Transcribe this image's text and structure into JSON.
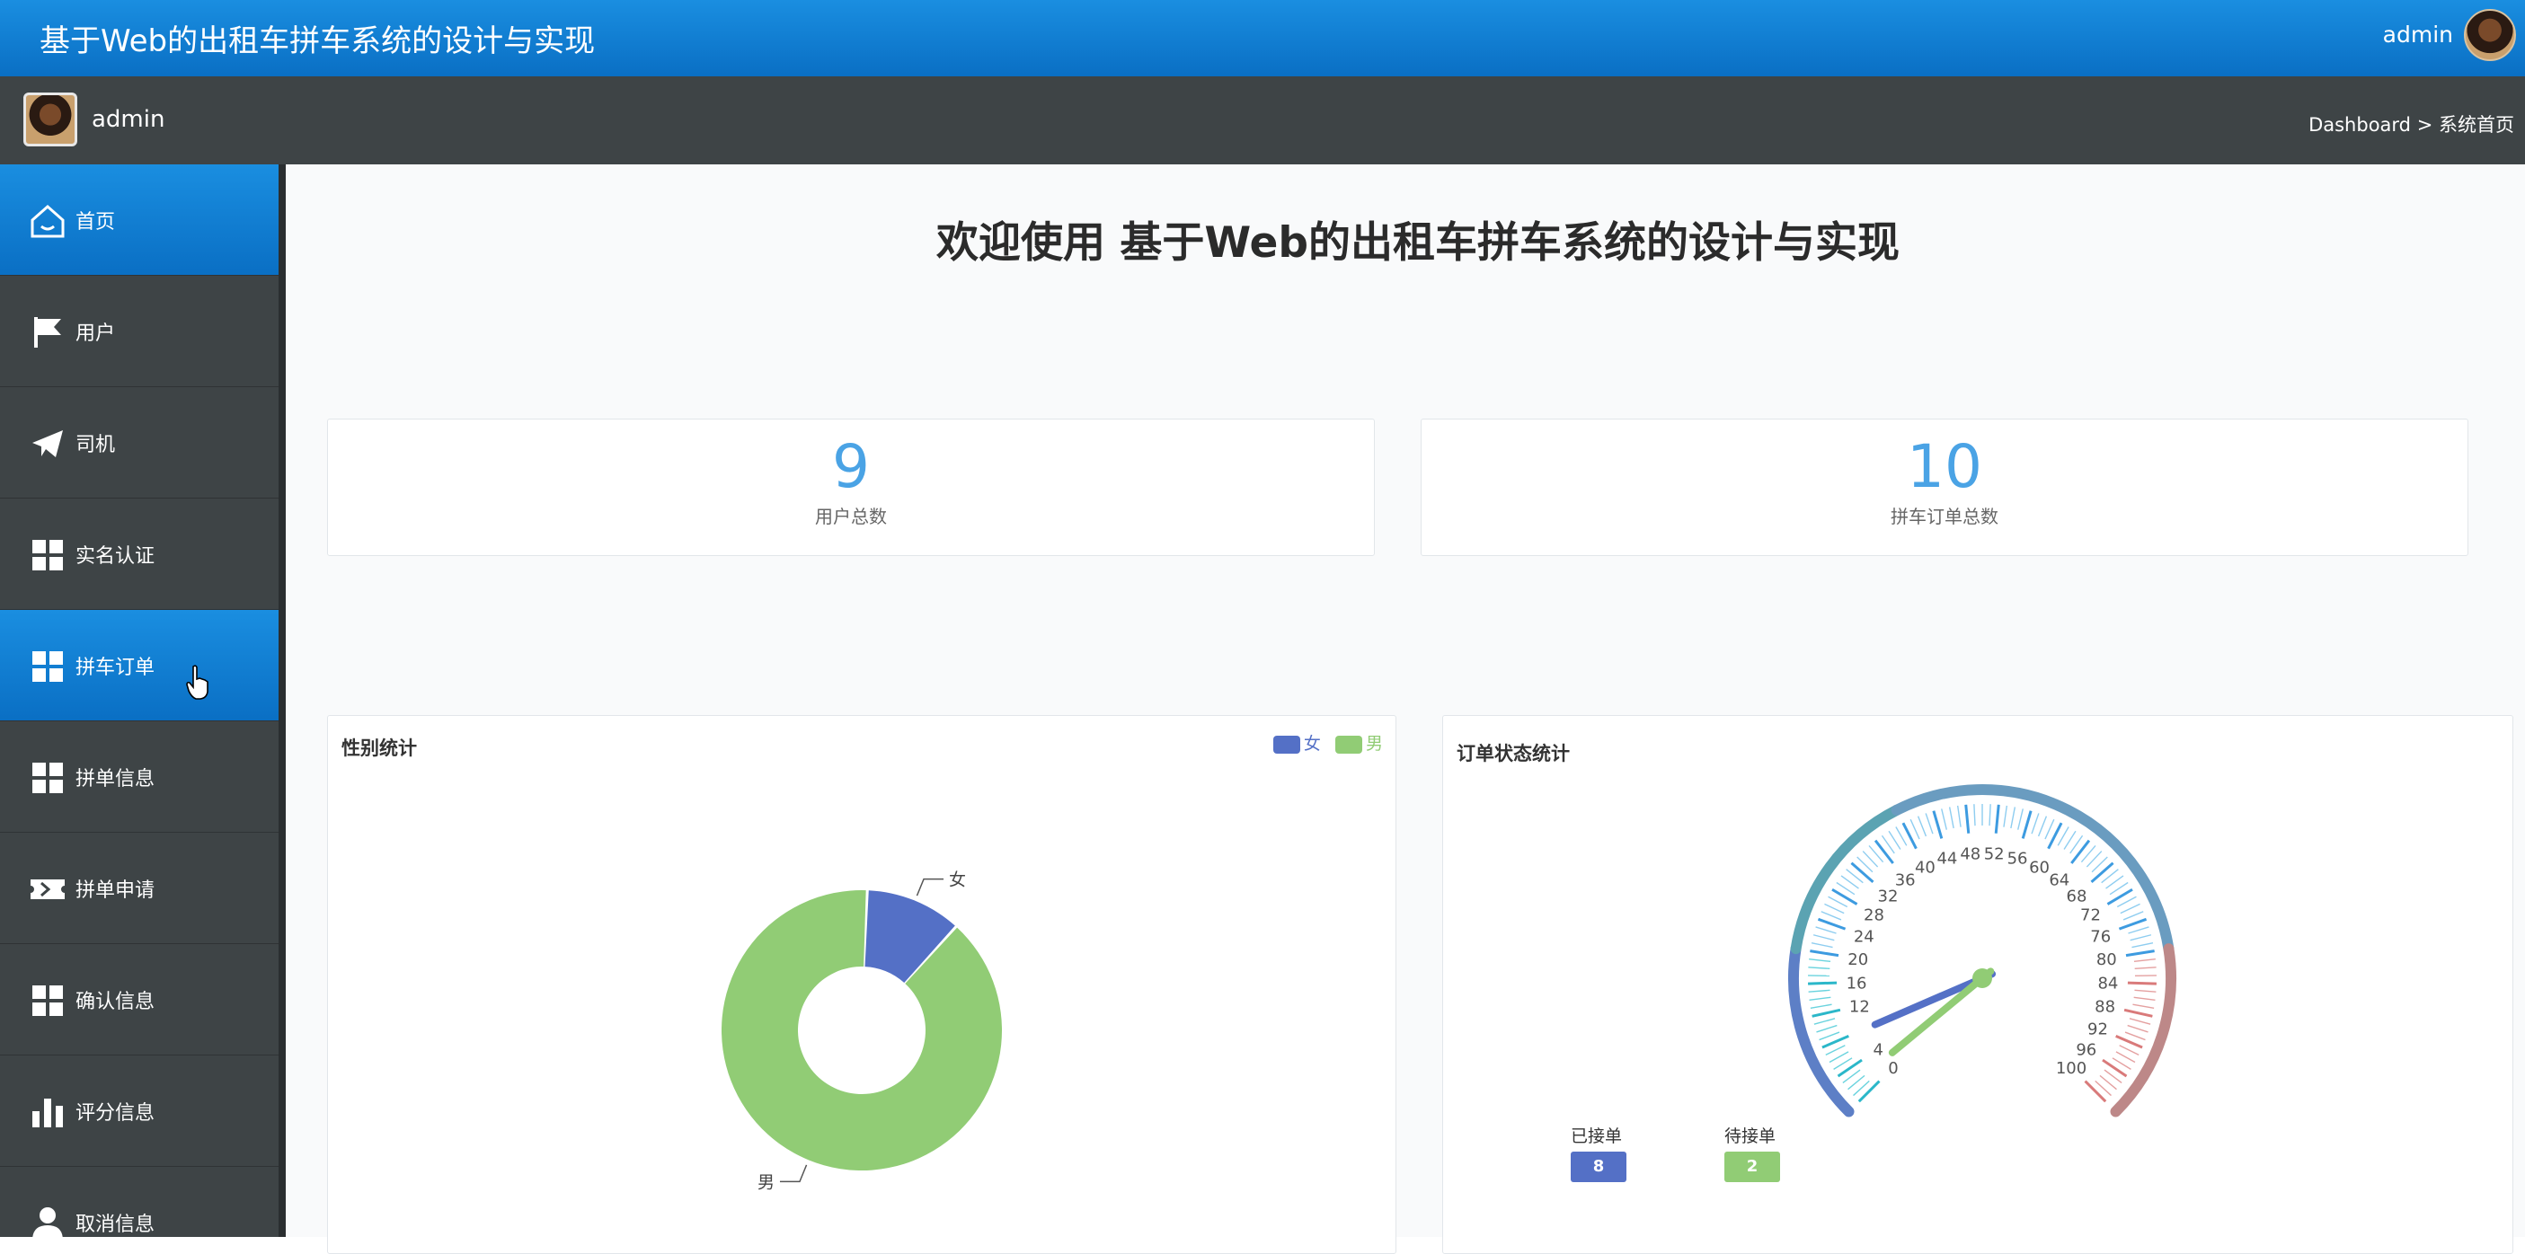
{
  "app": {
    "title": "基于Web的出租车拼车系统的设计与实现",
    "user": "admin"
  },
  "breadcrumb": {
    "root": "Dashboard",
    "separator": ">",
    "current": "系统首页"
  },
  "sidebar": {
    "user": "admin",
    "items": [
      {
        "label": "首页",
        "icon": "home-icon",
        "active": true
      },
      {
        "label": "用户",
        "icon": "flag-icon"
      },
      {
        "label": "司机",
        "icon": "paper-plane-icon"
      },
      {
        "label": "实名认证",
        "icon": "grid-icon"
      },
      {
        "label": "拼车订单",
        "icon": "grid-icon",
        "active": true
      },
      {
        "label": "拼单信息",
        "icon": "grid-icon"
      },
      {
        "label": "拼单申请",
        "icon": "ticket-icon"
      },
      {
        "label": "确认信息",
        "icon": "grid-icon"
      },
      {
        "label": "评分信息",
        "icon": "bar-chart-icon"
      },
      {
        "label": "取消信息",
        "icon": "user-icon"
      }
    ]
  },
  "main": {
    "welcome": "欢迎使用 基于Web的出租车拼车系统的设计与实现",
    "stats": [
      {
        "value": "9",
        "caption": "用户总数"
      },
      {
        "value": "10",
        "caption": "拼车订单总数"
      }
    ],
    "gender_panel": {
      "title": "性别统计"
    },
    "order_panel": {
      "title": "订单状态统计"
    }
  },
  "colors": {
    "accent": "#1a8ee0",
    "female": "#5470c6",
    "male": "#91cc75",
    "stat_number": "#4aa3e5",
    "sidebar": "#3e4446"
  },
  "chart_data": [
    {
      "type": "pie",
      "title": "性别统计",
      "legend": [
        "女",
        "男"
      ],
      "legend_position": "top-right",
      "slices": [
        {
          "name": "女",
          "value": 1
        },
        {
          "name": "男",
          "value": 8
        }
      ]
    },
    {
      "type": "gauge",
      "title": "订单状态统计",
      "range": [
        0,
        100
      ],
      "tick_labels": [
        "0",
        "4",
        "12",
        "16",
        "20",
        "24",
        "28",
        "32",
        "36",
        "40",
        "44",
        "48",
        "52",
        "56",
        "60",
        "64",
        "68",
        "72",
        "76",
        "80",
        "84",
        "88",
        "92",
        "96",
        "100"
      ],
      "series": [
        {
          "name": "已接单",
          "value": 8,
          "color": "#5470c6"
        },
        {
          "name": "待接单",
          "value": 2,
          "color": "#91cc75"
        }
      ]
    }
  ]
}
